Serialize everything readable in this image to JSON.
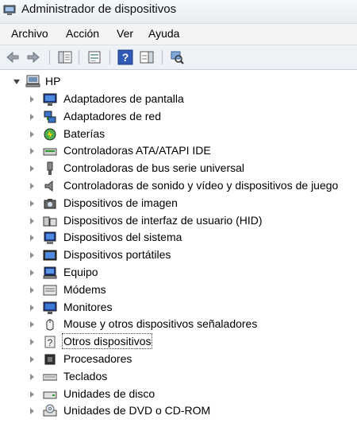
{
  "window": {
    "title": "Administrador de dispositivos"
  },
  "menu": [
    "Archivo",
    "Acción",
    "Ver",
    "Ayuda"
  ],
  "toolbar": {
    "buttons": [
      "back-arrow-icon",
      "forward-arrow-icon",
      "show-hide-tree-icon",
      "properties-icon",
      "help-icon",
      "action-pane-icon",
      "scan-hardware-icon"
    ]
  },
  "tree": {
    "root": "HP",
    "items": [
      {
        "label": "Adaptadores de pantalla",
        "icon": "display-adapter-icon"
      },
      {
        "label": "Adaptadores de red",
        "icon": "network-adapter-icon"
      },
      {
        "label": "Baterías",
        "icon": "battery-icon"
      },
      {
        "label": "Controladoras ATA/ATAPI IDE",
        "icon": "ide-controller-icon"
      },
      {
        "label": "Controladoras de bus serie universal",
        "icon": "usb-icon"
      },
      {
        "label": "Controladoras de sonido y vídeo y dispositivos de juego",
        "icon": "speaker-icon"
      },
      {
        "label": "Dispositivos de imagen",
        "icon": "camera-icon"
      },
      {
        "label": "Dispositivos de interfaz de usuario (HID)",
        "icon": "hid-icon"
      },
      {
        "label": "Dispositivos del sistema",
        "icon": "system-device-icon"
      },
      {
        "label": "Dispositivos portátiles",
        "icon": "portable-device-icon"
      },
      {
        "label": "Equipo",
        "icon": "computer-icon"
      },
      {
        "label": "Módems",
        "icon": "modem-icon"
      },
      {
        "label": "Monitores",
        "icon": "monitor-icon"
      },
      {
        "label": "Mouse y otros dispositivos señaladores",
        "icon": "mouse-icon"
      },
      {
        "label": "Otros dispositivos",
        "icon": "unknown-device-icon",
        "selected": true
      },
      {
        "label": "Procesadores",
        "icon": "processor-icon"
      },
      {
        "label": "Teclados",
        "icon": "keyboard-icon"
      },
      {
        "label": "Unidades de disco",
        "icon": "disk-drive-icon"
      },
      {
        "label": "Unidades de DVD o CD-ROM",
        "icon": "dvd-drive-icon"
      }
    ]
  }
}
